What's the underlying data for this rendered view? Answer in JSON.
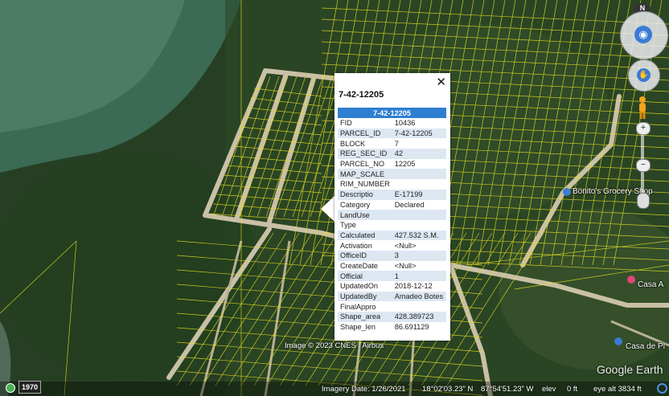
{
  "popup": {
    "title": "7-42-12205",
    "header": "7-42-12205",
    "close_glyph": "✕",
    "rows": [
      {
        "key": "FID",
        "value": "10436"
      },
      {
        "key": "PARCEL_ID",
        "value": "7-42-12205"
      },
      {
        "key": "BLOCK",
        "value": "7"
      },
      {
        "key": "REG_SEC_ID",
        "value": "42"
      },
      {
        "key": "PARCEL_NO",
        "value": "12205"
      },
      {
        "key": "MAP_SCALE",
        "value": ""
      },
      {
        "key": "RIM_NUMBER",
        "value": ""
      },
      {
        "key": "Descriptio",
        "value": "E-17199"
      },
      {
        "key": "Category",
        "value": "Declared"
      },
      {
        "key": "LandUse",
        "value": ""
      },
      {
        "key": "Type",
        "value": ""
      },
      {
        "key": "Calculated",
        "value": "427.532 S.M."
      },
      {
        "key": "Activation",
        "value": "<Null>"
      },
      {
        "key": "OfficeID",
        "value": "3"
      },
      {
        "key": "CreateDate",
        "value": "<Null>"
      },
      {
        "key": "Official",
        "value": "1"
      },
      {
        "key": "UpdatedOn",
        "value": "2018-12-12"
      },
      {
        "key": "UpdatedBy",
        "value": "Amadeo Botes"
      },
      {
        "key": "FinalAppro",
        "value": ""
      },
      {
        "key": "Shape_area",
        "value": "428.389723"
      },
      {
        "key": "Shape_len",
        "value": "86.691129"
      }
    ]
  },
  "places": {
    "grocery": "Bonito's Grocery Shop",
    "casa_a": "Casa A",
    "casa_p": "Casa de Pl"
  },
  "nav": {
    "north": "N",
    "zoom_in": "+",
    "zoom_out": "−"
  },
  "status": {
    "year": "1970",
    "imagery_date": "Imagery Date: 1/26/2021",
    "lat": "18°02'03.23\" N",
    "lon": "87°54'51.23\" W",
    "elev_label": "elev",
    "elev_value": "0 ft",
    "eye_alt": "eye alt   3834 ft"
  },
  "copyright": "Image © 2023 CNES / Airbus",
  "brand": "Google Earth",
  "colors": {
    "parcel_line": "#e8e020",
    "header_blue": "#2e7fd1",
    "pin_blue": "#3a7bd5",
    "pin_pink": "#e0457b"
  }
}
